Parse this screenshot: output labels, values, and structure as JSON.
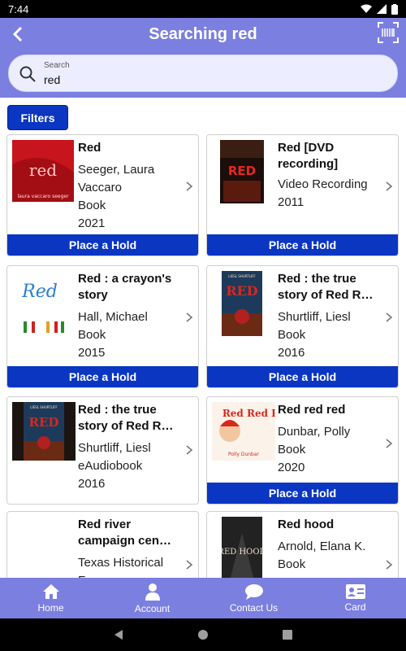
{
  "status": {
    "time": "7:44"
  },
  "header": {
    "title": "Searching red"
  },
  "search": {
    "label": "Search",
    "value": "red"
  },
  "filters_label": "Filters",
  "hold_label": "Place a Hold",
  "results": [
    {
      "title": "Red",
      "author": "Seeger, Laura Vaccaro",
      "format": "Book",
      "year": "2021",
      "cover_text": "red",
      "cover_sub": "laura vaccaro seeger"
    },
    {
      "title": "Red [DVD recording]",
      "format": "Video Recording",
      "year": "2011",
      "cover_text": "RED"
    },
    {
      "title": "Red : a crayon's story",
      "author": "Hall, Michael",
      "format": "Book",
      "year": "2015",
      "cover_text": "Red"
    },
    {
      "title": "Red : the true story of Red R…",
      "author": "Shurtliff, Liesl",
      "format": "Book",
      "year": "2016",
      "cover_text": "RED",
      "cover_top": "LIESL SHURTLIFF"
    },
    {
      "title": "Red : the true story of Red R…",
      "author": "Shurtliff, Liesl",
      "format": "eAudiobook",
      "year": "2016",
      "cover_text": "RED",
      "cover_top": "LIESL SHURTLIFF"
    },
    {
      "title": "Red red red",
      "author": "Dunbar, Polly",
      "format": "Book",
      "year": "2020",
      "cover_text": "Red Red Red",
      "cover_sub": "Polly Dunbar"
    },
    {
      "title": "Red river campaign cen…",
      "author": "Texas Historical F…"
    },
    {
      "title": "Red hood",
      "author": "Arnold, Elana K.",
      "format": "Book",
      "cover_text": "RED HOOD"
    }
  ],
  "nav": {
    "home": "Home",
    "account": "Account",
    "contact": "Contact Us",
    "card": "Card"
  },
  "colors": {
    "appbar": "#7b7fe0",
    "button": "#0a36c2"
  }
}
